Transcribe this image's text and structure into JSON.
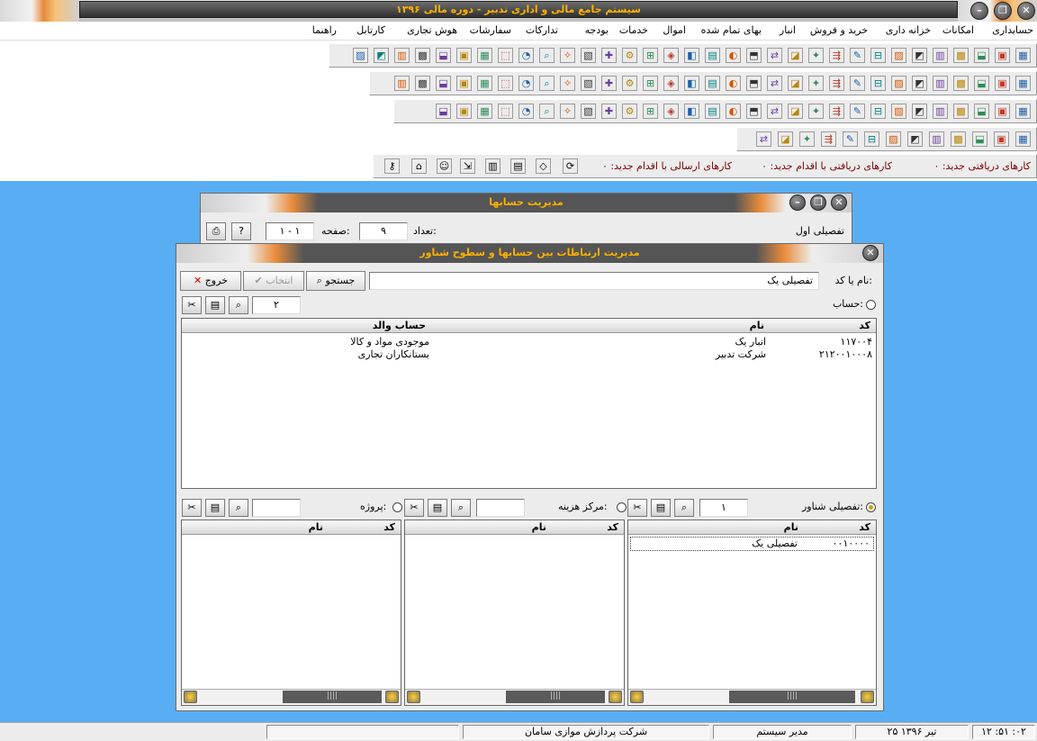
{
  "app": {
    "title": "سیستم جامع مالی و اداری تدبیر - دوره مالی ۱۳۹۶",
    "menu": [
      "حسابداری",
      "امکانات",
      "خزانه داری",
      "خرید و فروش",
      "انبار",
      "بهای تمام شده",
      "اموال",
      "خدمات",
      "بودجه",
      "تدارکات",
      "سفارشات",
      "هوش تجاری",
      "کارتابل",
      "راهنما"
    ],
    "notifications": {
      "received_new": "کارهای دریافتی جدید: ۰",
      "received_action": "کارهای دریافتی با اقدام جدید: ۰",
      "sent_action": "کارهای ارسالی با اقدام جدید: ۰"
    }
  },
  "status": {
    "time": "۱۲ :۵۱ :۰۲",
    "date": "۲۵ تیر ۱۳۹۶",
    "user": "مدیر سیستم",
    "company": "شرکت پردازش موازی سامان"
  },
  "accounts_window": {
    "title": "مدیریت حسابها",
    "count_label": "تعداد:",
    "count_value": "۹",
    "page_label": "صفحه:",
    "page_value": "۱ - ۱",
    "level_text": "تفصیلی اول"
  },
  "relations_window": {
    "title": "مدیریت ارتباطات بین حسابها و سطوح شناور",
    "name_or_code_label": "نام یا کد:",
    "name_or_code_value": "تفصیلی یک",
    "search_label": "جستجو",
    "select_label": "انتخاب",
    "exit_label": "خروج",
    "account_label": "حساب:",
    "account_count": "۲",
    "account_grid": {
      "columns": [
        "کد",
        "نام",
        "حساب والد"
      ],
      "rows": [
        {
          "code": "۱۱۷۰۰۴",
          "name": "انبار یک",
          "parent": "موجودی مواد و کالا"
        },
        {
          "code": "۲۱۲۰۰۱۰۰۰۸",
          "name": "شرکت تدبیر",
          "parent": "بستانکاران تجاری"
        }
      ]
    },
    "floating_detail_label": "تفصیلی شناور:",
    "floating_detail_count": "۱",
    "cost_center_label": "مرکز هزینه:",
    "cost_center_count": "",
    "project_label": "پروژه:",
    "project_count": "",
    "floating_grid": {
      "columns": [
        "کد",
        "نام"
      ],
      "rows": [
        {
          "code": "۰۰۱۰۰۰۰",
          "name": "تفصیلی یک"
        }
      ]
    },
    "cost_grid": {
      "columns": [
        "کد",
        "نام"
      ]
    },
    "project_grid": {
      "columns": [
        "کد",
        "نام"
      ]
    }
  },
  "colors": {
    "desktop": "#58adf3",
    "title_text": "#ffb000",
    "title_bar": "#444444"
  }
}
